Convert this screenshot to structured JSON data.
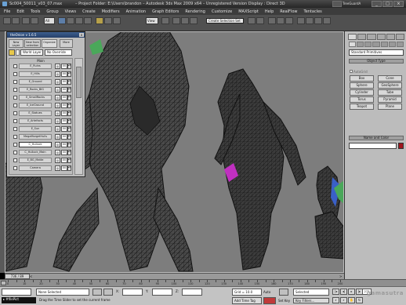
{
  "window": {
    "file_title": "Sc004_50011_v03_07.max",
    "centre_title": "–  Project Folder: E:\\Users\\brandon     –  Autodesk 3ds Max  2009 x64  –  Unregistered Version              Display : Direct 3D",
    "right_label": "TreeGuardA",
    "min": "_",
    "max": "□",
    "close": "×"
  },
  "menus": [
    "File",
    "Edit",
    "Tools",
    "Group",
    "Views",
    "Create",
    "Modifiers",
    "Animation",
    "Graph Editors",
    "Rendering",
    "Customize",
    "MAXScript",
    "Help",
    "RealFlow",
    "Tentacles"
  ],
  "toolbar": {
    "filter": "All",
    "view": "View",
    "selection_set_placeholder": "Create Selection Set"
  },
  "onion": {
    "title": "theOnion v 1.6.5",
    "close": "x",
    "tabs": [
      "New Layer",
      "New from selection",
      "Organize",
      "More"
    ],
    "current_layer": "World Layer",
    "override": "No Override",
    "group_label": "Main",
    "layers": [
      {
        "name": "E_Ruins",
        "value": "00",
        "checked": true
      },
      {
        "name": "E_Hills",
        "value": "00",
        "checked": true
      },
      {
        "name": "E_Ground",
        "value": "00",
        "checked": true
      },
      {
        "name": "E_Rocks_BIG",
        "value": "00",
        "checked": true
      },
      {
        "name": "E_SmallRocks",
        "value": "00",
        "checked": true
      },
      {
        "name": "E_IceGround",
        "value": "00",
        "checked": true
      },
      {
        "name": "E_Statues",
        "value": "00",
        "checked": true
      },
      {
        "name": "E_Artefacts",
        "value": "00",
        "checked": true
      },
      {
        "name": "E_Sun",
        "value": "00",
        "checked": true
      },
      {
        "name": "MegaMorgelHulls",
        "value": "00",
        "checked": true
      },
      {
        "name": "C_Hullock",
        "value": "00",
        "checked": true,
        "selected": true
      },
      {
        "name": "C_Hullock_Main",
        "value": "00",
        "checked": true
      },
      {
        "name": "E_BG_Matte",
        "value": "00",
        "checked": true
      },
      {
        "name": "Camera",
        "value": "00",
        "checked": true
      }
    ]
  },
  "command_panel": {
    "primitives": "Standard Primitives",
    "object_type_header": "Object Type",
    "autogrid": "AutoGrid",
    "objects": [
      "Box",
      "Cone",
      "Sphere",
      "GeoSphere",
      "Cylinder",
      "Tube",
      "Torus",
      "Pyramid",
      "Teapot",
      "Plane"
    ],
    "name_color_header": "Name and Color",
    "object_color": "#a0161e"
  },
  "timeline": {
    "current": "736 / 89",
    "prev": "<",
    "next": ">",
    "ticks": [
      "0",
      "10",
      "20",
      "30",
      "40",
      "50",
      "60",
      "70",
      "80",
      "90",
      "100",
      "110",
      "120",
      "130",
      "140",
      "150",
      "160",
      "170",
      "180",
      "190",
      "200"
    ]
  },
  "status": {
    "selection": "None Selected",
    "x_label": "X:",
    "y_label": "Y:",
    "z_label": "Z:",
    "grid": "Grid = 10.0",
    "auto_key": "Auto Key",
    "set_key": "Set Key",
    "key_mode": "Selected",
    "key_filters": "Key Filters...",
    "frame": "273",
    "maxscript_prompt": "▸ #filePict",
    "prompt": "Drag the Time Slider to set the current frame",
    "add_time_tag": "Add Time Tag",
    "watermark": "gamasutra"
  },
  "colors": {
    "viewport_bg": "#7d7d7d",
    "mesh": "#1c1c1c",
    "accent_magenta": "#c030c0",
    "accent_green": "#4aa85a",
    "accent_blue": "#3a60c8"
  }
}
